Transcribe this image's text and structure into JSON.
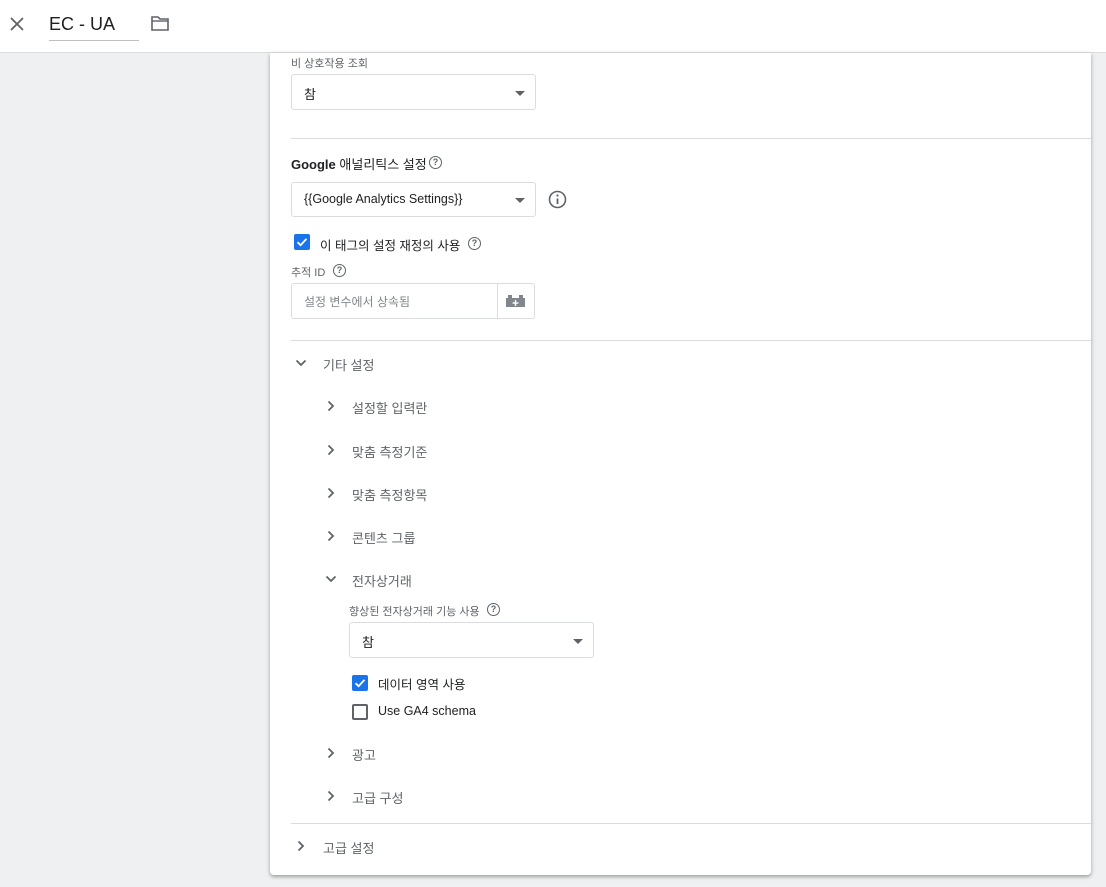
{
  "header": {
    "title": "EC - UA"
  },
  "fields": {
    "non_interaction_label": "비 상호작용 조회",
    "non_interaction_value": "참",
    "ga_settings_label": "Google",
    "ga_settings_label_suffix": " 애널리틱스 설정",
    "ga_settings_value": "{{Google Analytics Settings}}",
    "override_label": "이 태그의 설정 재정의 사용",
    "tracking_id_label": "추적 ID",
    "tracking_id_placeholder": "설정 변수에서 상속됨"
  },
  "sections": {
    "more_settings": "기타 설정",
    "fields_to_set": "설정할 입력란",
    "custom_dimensions": "맞춤 측정기준",
    "custom_metrics": "맞춤 측정항목",
    "content_groups": "콘텐츠 그룹",
    "ecommerce": "전자상거래",
    "advertising": "광고",
    "advanced_config": "고급 구성",
    "advanced_settings": "고급 설정"
  },
  "ecommerce": {
    "enhanced_label": "향상된 전자상거래 기능 사용",
    "enhanced_value": "참",
    "data_layer_label": "데이터 영역 사용",
    "data_layer_checked": true,
    "ga4_schema_label": "Use GA4 schema",
    "ga4_schema_checked": false
  },
  "colors": {
    "accent": "#1a73e8",
    "background": "#eff0f1"
  }
}
